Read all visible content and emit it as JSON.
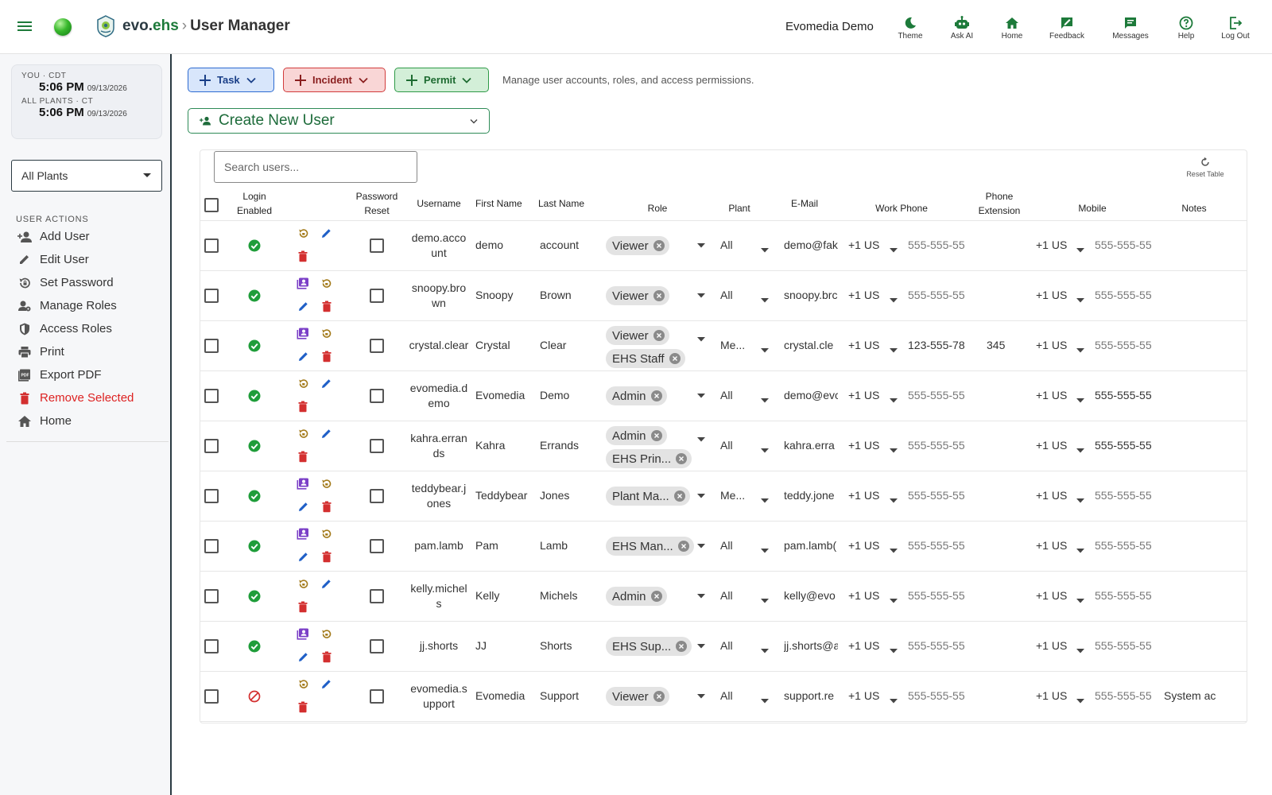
{
  "topbar": {
    "brand_evo": "evo.",
    "brand_ehs": "ehs",
    "separator": "›",
    "page_title": "User Manager",
    "org_name": "Evomedia Demo",
    "nav": [
      {
        "label": "Theme",
        "icon": "moon-icon"
      },
      {
        "label": "Ask AI",
        "icon": "robot-icon"
      },
      {
        "label": "Home",
        "icon": "home-icon"
      },
      {
        "label": "Feedback",
        "icon": "feedback-icon"
      },
      {
        "label": "Messages",
        "icon": "message-icon"
      },
      {
        "label": "Help",
        "icon": "help-icon"
      },
      {
        "label": "Log Out",
        "icon": "logout-icon"
      }
    ]
  },
  "sidebar": {
    "clock": {
      "you_label": "YOU · CDT",
      "you_time": "5:06 PM",
      "you_date": "09/13/2026",
      "plants_label": "ALL PLANTS · CT",
      "plants_time": "5:06 PM",
      "plants_date": "09/13/2026"
    },
    "plant_select": "All Plants",
    "section_title": "USER ACTIONS",
    "actions": [
      {
        "label": "Add User",
        "icon": "add-user-icon"
      },
      {
        "label": "Edit User",
        "icon": "pencil-icon"
      },
      {
        "label": "Set Password",
        "icon": "password-reset-icon"
      },
      {
        "label": "Manage Roles",
        "icon": "manage-roles-icon"
      },
      {
        "label": "Access Roles",
        "icon": "shield-icon"
      },
      {
        "label": "Print",
        "icon": "printer-icon"
      },
      {
        "label": "Export PDF",
        "icon": "pdf-icon"
      },
      {
        "label": "Remove Selected",
        "icon": "trash-icon"
      },
      {
        "label": "Home",
        "icon": "home-icon"
      }
    ]
  },
  "toolbar": {
    "task": "Task",
    "incident": "Incident",
    "permit": "Permit",
    "hint": "Manage user accounts, roles, and access permissions.",
    "create_user": "Create New User"
  },
  "table": {
    "search_placeholder": "Search users...",
    "reset_label": "Reset Table",
    "headers": {
      "login_enabled": "Login Enabled",
      "password_reset": "Password Reset",
      "username": "Username",
      "first_name": "First Name",
      "last_name": "Last Name",
      "role": "Role",
      "plant": "Plant",
      "email": "E-Mail",
      "work_phone": "Work Phone",
      "phone_extension": "Phone Extension",
      "mobile": "Mobile",
      "notes": "Notes"
    },
    "rows": [
      {
        "username": "demo.account",
        "first": "demo",
        "last": "account",
        "roles": [
          "Viewer"
        ],
        "plant": "All",
        "email": "demo@fak",
        "work_cc": "+1 US",
        "work_phone": "555-555-55",
        "ext": "",
        "mobile_cc": "+1 US",
        "mobile": "555-555-55",
        "notes": "",
        "login_enabled": true,
        "has_roles_icon": false,
        "mobile_dark": false
      },
      {
        "username": "snoopy.brown",
        "first": "Snoopy",
        "last": "Brown",
        "roles": [
          "Viewer"
        ],
        "plant": "All",
        "email": "snoopy.brc",
        "work_cc": "+1 US",
        "work_phone": "555-555-55",
        "ext": "",
        "mobile_cc": "+1 US",
        "mobile": "555-555-55",
        "notes": "",
        "login_enabled": true,
        "has_roles_icon": true,
        "mobile_dark": false
      },
      {
        "username": "crystal.clear",
        "first": "Crystal",
        "last": "Clear",
        "roles": [
          "Viewer",
          "EHS Staff"
        ],
        "plant": "Me...",
        "email": "crystal.cle",
        "work_cc": "+1 US",
        "work_phone": "123-555-78",
        "ext": "345",
        "mobile_cc": "+1 US",
        "mobile": "555-555-55",
        "notes": "",
        "login_enabled": true,
        "has_roles_icon": true,
        "mobile_dark": false
      },
      {
        "username": "evomedia.demo",
        "first": "Evomedia",
        "last": "Demo",
        "roles": [
          "Admin"
        ],
        "plant": "All",
        "email": "demo@evc",
        "work_cc": "+1 US",
        "work_phone": "555-555-55",
        "ext": "",
        "mobile_cc": "+1 US",
        "mobile": "555-555-55",
        "notes": "",
        "login_enabled": true,
        "has_roles_icon": false,
        "mobile_dark": true
      },
      {
        "username": "kahra.errands",
        "first": "Kahra",
        "last": "Errands",
        "roles": [
          "Admin",
          "EHS Prin..."
        ],
        "plant": "All",
        "email": "kahra.erra",
        "work_cc": "+1 US",
        "work_phone": "555-555-55",
        "ext": "",
        "mobile_cc": "+1 US",
        "mobile": "555-555-55",
        "notes": "",
        "login_enabled": true,
        "has_roles_icon": false,
        "mobile_dark": true
      },
      {
        "username": "teddybear.jones",
        "first": "Teddybear",
        "last": "Jones",
        "roles": [
          "Plant Ma..."
        ],
        "plant": "Me...",
        "email": "teddy.jone",
        "work_cc": "+1 US",
        "work_phone": "555-555-55",
        "ext": "",
        "mobile_cc": "+1 US",
        "mobile": "555-555-55",
        "notes": "",
        "login_enabled": true,
        "has_roles_icon": true,
        "mobile_dark": false
      },
      {
        "username": "pam.lamb",
        "first": "Pam",
        "last": "Lamb",
        "roles": [
          "EHS Man..."
        ],
        "plant": "All",
        "email": "pam.lamb(",
        "work_cc": "+1 US",
        "work_phone": "555-555-55",
        "ext": "",
        "mobile_cc": "+1 US",
        "mobile": "555-555-55",
        "notes": "",
        "login_enabled": true,
        "has_roles_icon": true,
        "mobile_dark": false
      },
      {
        "username": "kelly.michels",
        "first": "Kelly",
        "last": "Michels",
        "roles": [
          "Admin"
        ],
        "plant": "All",
        "email": "kelly@evo",
        "work_cc": "+1 US",
        "work_phone": "555-555-55",
        "ext": "",
        "mobile_cc": "+1 US",
        "mobile": "555-555-55",
        "notes": "",
        "login_enabled": true,
        "has_roles_icon": false,
        "mobile_dark": false
      },
      {
        "username": "jj.shorts",
        "first": "JJ",
        "last": "Shorts",
        "roles": [
          "EHS Sup..."
        ],
        "plant": "All",
        "email": "jj.shorts@a",
        "work_cc": "+1 US",
        "work_phone": "555-555-55",
        "ext": "",
        "mobile_cc": "+1 US",
        "mobile": "555-555-55",
        "notes": "",
        "login_enabled": true,
        "has_roles_icon": true,
        "mobile_dark": false
      },
      {
        "username": "evomedia.support",
        "first": "Evomedia",
        "last": "Support",
        "roles": [
          "Viewer"
        ],
        "plant": "All",
        "email": "support.re",
        "work_cc": "+1 US",
        "work_phone": "555-555-55",
        "ext": "",
        "mobile_cc": "+1 US",
        "mobile": "555-555-55",
        "notes": "System ac",
        "login_enabled": false,
        "has_roles_icon": false,
        "mobile_dark": false
      }
    ]
  },
  "colors": {
    "green": "#1f9d3a",
    "red": "#d32f2f",
    "blue": "#1f5fc7",
    "purple": "#7b3fc7",
    "gold": "#a37a1a",
    "brand": "#1d7a3a"
  }
}
